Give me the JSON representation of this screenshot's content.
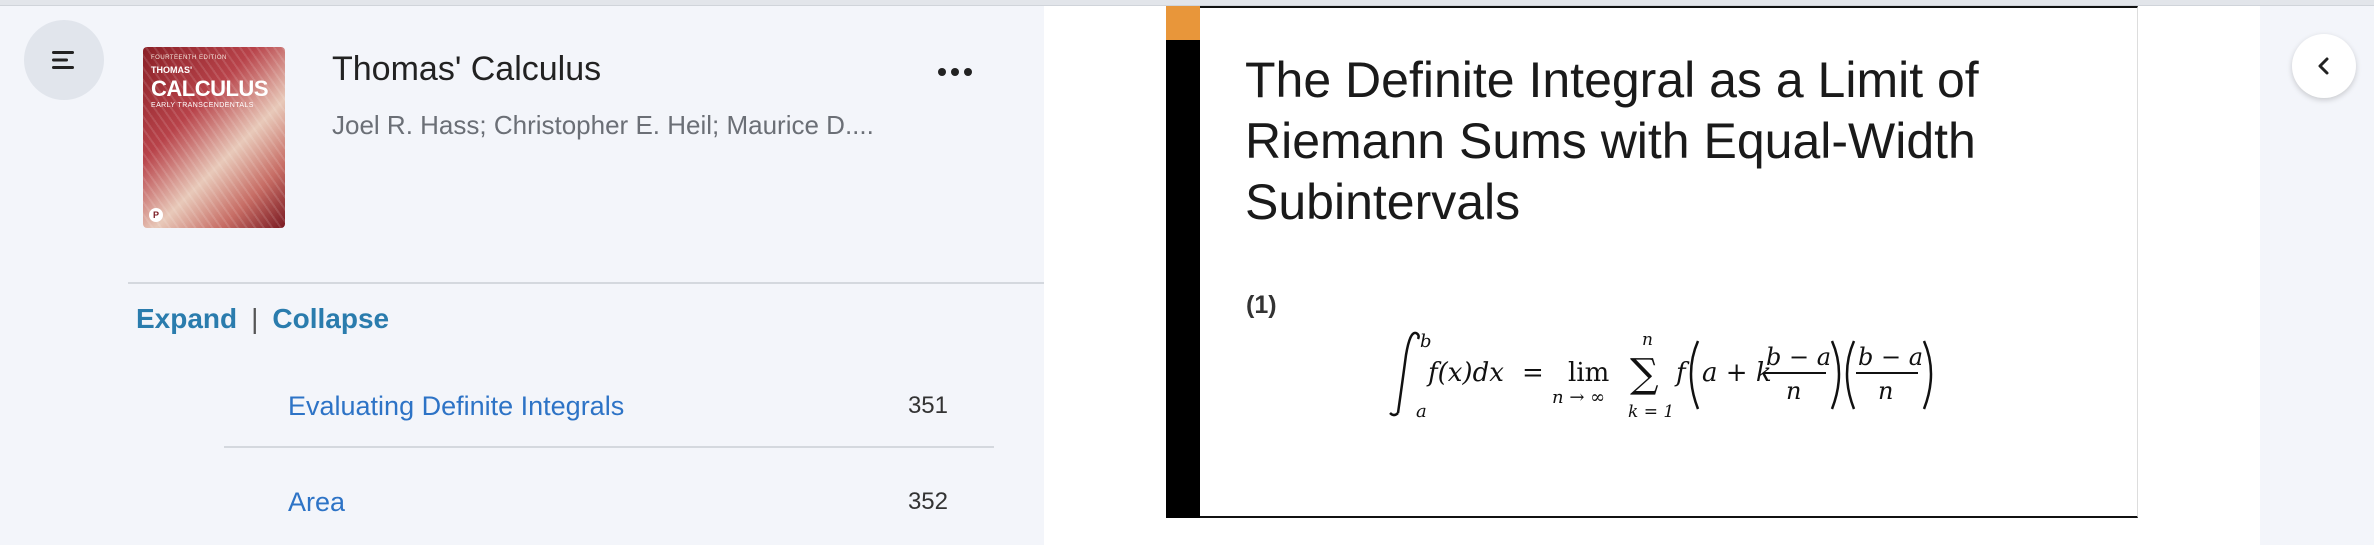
{
  "book": {
    "title": "Thomas' Calculus",
    "authors": "Joel R. Hass; Christopher E. Heil; Maurice D....",
    "cover": {
      "series": "FOURTEENTH EDITION",
      "title_top": "THOMAS'",
      "title": "CALCULUS",
      "subtitle": "EARLY TRANSCENDENTALS",
      "logo": "P"
    }
  },
  "toolbar": {
    "menu_icon": "hamburger-menu-icon",
    "more_icon": "more-horizontal-icon",
    "more_label": "•••"
  },
  "toc": {
    "expand_label": "Expand",
    "separator": "|",
    "collapse_label": "Collapse",
    "items": [
      {
        "label": "Evaluating Definite Integrals",
        "page": "351"
      },
      {
        "label": "Area",
        "page": "352"
      }
    ]
  },
  "reader": {
    "section_title": "The Definite Integral as a Limit of Riemann Sums with Equal-Width Subintervals",
    "equation_number": "(1)",
    "equation": {
      "int_upper": "b",
      "int_lower": "a",
      "integrand": "f(x)dx",
      "equals": "=",
      "lim": "lim",
      "lim_sub": "n → ∞",
      "sum_upper": "n",
      "sum_lower": "k = 1",
      "f": "f",
      "a_plus_k": "a + k",
      "frac_num": "b − a",
      "frac_den": "n"
    },
    "accent_color": "#e8963a"
  },
  "side": {
    "collapse_icon": "chevron-left-icon"
  }
}
